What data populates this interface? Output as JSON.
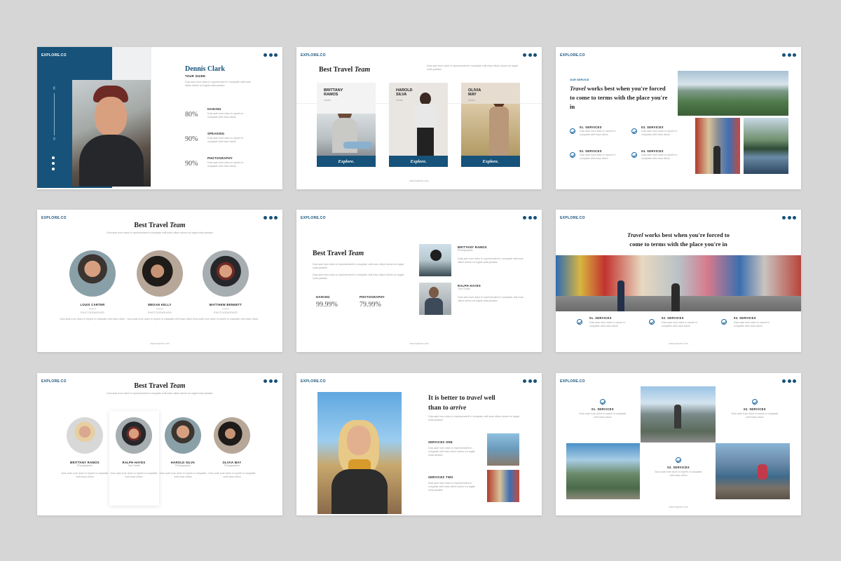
{
  "brand": "EXPLORE.CO",
  "footer": "www.explore.com",
  "lorem2": "Duis aute irure dolor in repreh in voluptate velit esse cillum",
  "lorem3": "Duis aute irure dolor in reprehenderit in voluptate velit esse cillum dolore eu fugiat nulla pariatur",
  "s1": {
    "name": "Dennis Clark",
    "role": "TOUR GUIDE",
    "n1": "05",
    "n2": "01",
    "skills": [
      {
        "pct": "80%",
        "label": "HAIKING"
      },
      {
        "pct": "90%",
        "label": "SPEAKING"
      },
      {
        "pct": "90%",
        "label": "PHOTOGRAPHY"
      }
    ]
  },
  "s2": {
    "title_a": "Best Travel",
    "title_b": "Team",
    "cards": [
      {
        "first": "BRITTANY",
        "last": "RAMOS",
        "role": "Guide",
        "btn": "Explore."
      },
      {
        "first": "HAROLD",
        "last": "SILVA",
        "role": "Guide",
        "btn": "Explore."
      },
      {
        "first": "OLIVIA",
        "last": "MAY",
        "role": "Guide",
        "btn": "Explore."
      }
    ]
  },
  "s3": {
    "kicker": "OUR SERVICE",
    "h_a": "Travel",
    "h_b": " works best when you're forced to come to terms with the place you're in",
    "services": [
      "01. SERVICES",
      "03. SERVICES",
      "02. SERVICES",
      "04. SERVICES"
    ]
  },
  "s4": {
    "title_a": "Best Travel",
    "title_b": "Team",
    "people": [
      {
        "name": "LOUIS CARTER",
        "role": "PHOTOGRAPHER"
      },
      {
        "name": "MEGAN KELLY",
        "role": "PHOTOGRAPHER"
      },
      {
        "name": "MATTHEW BENNETT",
        "role": "PHOTOGRAPHER"
      }
    ]
  },
  "s5": {
    "title_a": "Best Travel",
    "title_b": "Team",
    "stats": [
      {
        "label": "HAIKING",
        "value": "99.99%"
      },
      {
        "label": "PHOTOGRAPHY",
        "value": "79.99%"
      }
    ],
    "people": [
      {
        "name": "BRITTANY RAMOS",
        "role": "Photographer"
      },
      {
        "name": "RALPH HAYES",
        "role": "Tour Guide"
      }
    ]
  },
  "s6": {
    "h_a": "Travel",
    "h_b": " works best when you're forced to",
    "h_c": "come to terms with the place you're in",
    "services": [
      "01. SERVICES",
      "02. SERVICES",
      "03. SERVICES"
    ]
  },
  "s7": {
    "title_a": "Best Travel",
    "title_b": "Team",
    "people": [
      {
        "name": "BRITTANY RAMOS",
        "role": "Photographer"
      },
      {
        "name": "RALPH HAYES",
        "role": "Tour Guide"
      },
      {
        "name": "HAROLD SILVA",
        "role": "Photographer"
      },
      {
        "name": "OLIVIA MAY",
        "role": "Photographer"
      }
    ]
  },
  "s8": {
    "h1": "It is better to",
    "h_it1": "travel",
    "h2": " well",
    "h3": "than to",
    "h_it2": "arrive",
    "services": [
      "SERVICES ONE",
      "SERVICES TWO"
    ]
  },
  "s9": {
    "services": [
      "01. SERVICES",
      "02. SERVICES",
      "03. SERVICES"
    ]
  },
  "colors": {
    "accent": "#17527a",
    "bg": "#d6d6d6"
  }
}
